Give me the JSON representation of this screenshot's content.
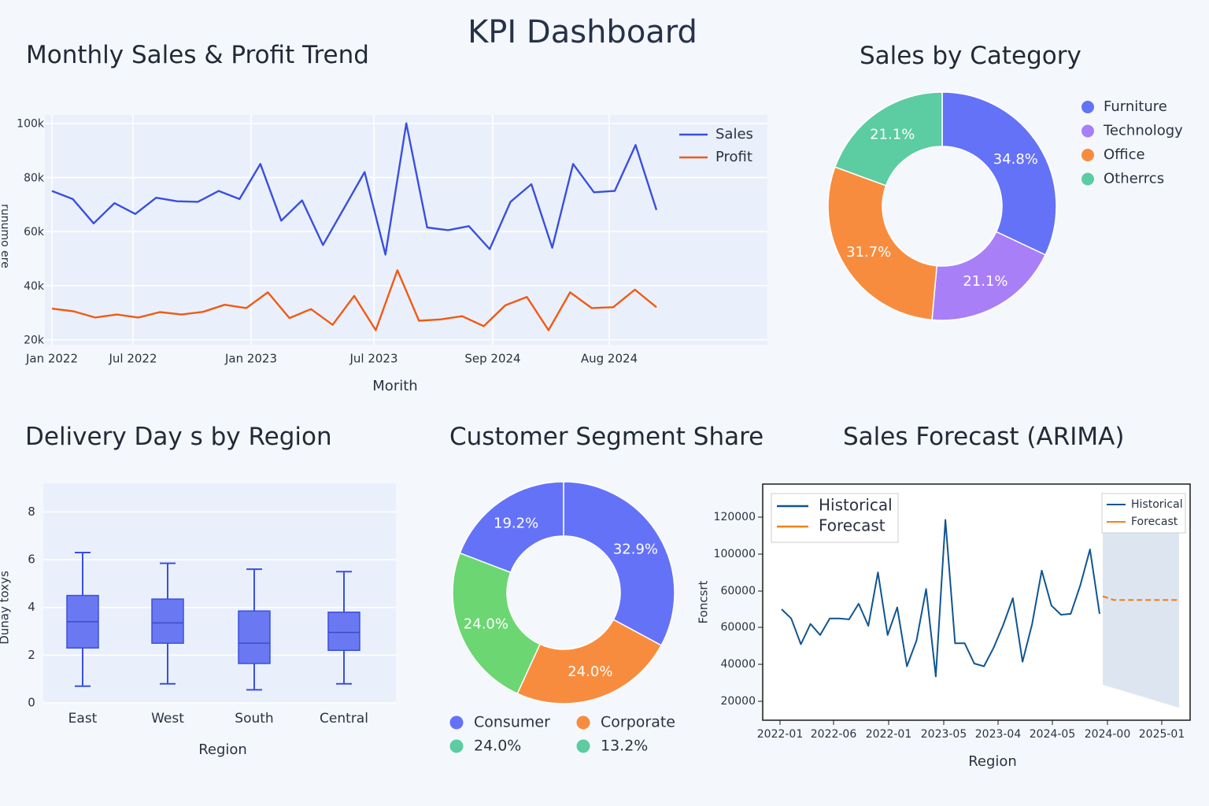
{
  "dashboard": {
    "title": "KPI Dashboard"
  },
  "colors": {
    "plot_bg": "#eaf0fb",
    "sales": "#3a4fe0",
    "profit": "#f05a14",
    "indigo": "#6472f8",
    "purple": "#a97ff8",
    "orange": "#f88c3e",
    "teal": "#5ccca2",
    "green": "#6cd672",
    "navy": "#0f5592",
    "fc_orange": "#f47f1a"
  },
  "panels": {
    "trend": {
      "title": "Monthly Sales & Profit Trend",
      "xlabel": "Morith",
      "ylabel": "runumo ere",
      "legend": [
        "Sales",
        "Profit"
      ]
    },
    "category": {
      "title": "Sales by Category",
      "legend": [
        "Furniture",
        "Technology",
        "Office",
        "Otherrcs"
      ]
    },
    "delivery": {
      "title": "Delivery Day s by Region",
      "xlabel": "Region",
      "ylabel": "Dunay toxys"
    },
    "segment": {
      "title": "Customer Segment Share",
      "legend": [
        "Consumer",
        "Corporate",
        "24.0%",
        "13.2%"
      ]
    },
    "forecast": {
      "title": "Sales Forecast (ARIMA)",
      "xlabel": "Region",
      "ylabel": "Foncsrt",
      "legend_main": [
        "Historical",
        "Forecast"
      ],
      "legend_small": [
        "Historical",
        "Forecast"
      ]
    }
  },
  "chart_data": [
    {
      "type": "line",
      "title": "Monthly Sales & Profit Trend",
      "xlabel": "Morith",
      "ylabel": "runumo ere",
      "xtick_labels": [
        "Jan 2022",
        "Jul 2022",
        "Jan 2023",
        "Jul 2023",
        "Sep 2024",
        "Aug 2024"
      ],
      "yticks": [
        20000,
        40000,
        60000,
        80000,
        100000
      ],
      "ytick_labels": [
        "20k",
        "40k",
        "60k",
        "80k",
        "100k"
      ],
      "ylim": [
        19000,
        104000
      ],
      "legend_position": "top-right",
      "grid": true,
      "series": [
        {
          "name": "Sales",
          "values": [
            75000,
            72000,
            63000,
            70500,
            66500,
            72500,
            71200,
            71000,
            75000,
            72000,
            85000,
            64000,
            71500,
            55000,
            68500,
            82000,
            51500,
            100000,
            61500,
            60500,
            62000,
            53500,
            71000,
            77500,
            54000,
            85000,
            74500,
            75000,
            92000,
            68000
          ]
        },
        {
          "name": "Profit",
          "values": [
            31500,
            30500,
            28200,
            29300,
            28200,
            30200,
            29300,
            30300,
            32900,
            31700,
            37500,
            28000,
            31300,
            25500,
            36200,
            23500,
            45700,
            27000,
            27500,
            28700,
            25000,
            32700,
            35800,
            23500,
            37500,
            31700,
            32000,
            38500,
            32000
          ]
        }
      ]
    },
    {
      "type": "pie",
      "title": "Sales by Category",
      "donut": true,
      "categories": [
        "Furniture",
        "Technology",
        "Office",
        "Otherrcs"
      ],
      "values": [
        34.8,
        21.1,
        31.7,
        21.1
      ],
      "labels": [
        "34.8%",
        "21.1%",
        "31.7%",
        "21.1%"
      ],
      "legend_position": "right"
    },
    {
      "type": "box",
      "title": "Delivery Day s by Region",
      "xlabel": "Region",
      "ylabel": "Dunay toxys",
      "categories": [
        "East",
        "West",
        "South",
        "Central"
      ],
      "boxes": [
        {
          "min": 0.7,
          "q1": 2.3,
          "median": 3.4,
          "q3": 4.5,
          "max": 6.3
        },
        {
          "min": 0.8,
          "q1": 2.5,
          "median": 3.35,
          "q3": 4.35,
          "max": 5.85
        },
        {
          "min": 0.55,
          "q1": 1.65,
          "median": 2.5,
          "q3": 3.85,
          "max": 5.6
        },
        {
          "min": 0.8,
          "q1": 2.2,
          "median": 2.95,
          "q3": 3.8,
          "max": 5.5
        }
      ],
      "yticks": [
        0,
        2,
        4,
        6,
        8
      ],
      "ylim": [
        0,
        9.2
      ],
      "grid": true
    },
    {
      "type": "pie",
      "title": "Customer Segment Share",
      "donut": true,
      "values": [
        32.9,
        24.0,
        24.0,
        19.2
      ],
      "labels": [
        "32.9%",
        "24.0%",
        "24.0%",
        "19.2%"
      ],
      "legend_entries": [
        "Consumer",
        "Corporate",
        "24.0%",
        "13.2%"
      ],
      "legend_position": "bottom"
    },
    {
      "type": "line",
      "title": "Sales Forecast (ARIMA)",
      "xlabel": "Region",
      "ylabel": "Foncsrt",
      "xtick_labels": [
        "2022-01",
        "2022-06",
        "2022-01",
        "2023-05",
        "2023-04",
        "2024-05",
        "2024-00",
        "2025-01"
      ],
      "ytick_labels": [
        "20000",
        "40000",
        "60000",
        "60000",
        "100000",
        "120000"
      ],
      "legend_position": "top-left",
      "grid": false,
      "series": [
        {
          "name": "Historical",
          "values": [
            70000,
            65000,
            51000,
            62000,
            56000,
            65000,
            65000,
            64500,
            73000,
            61000,
            90000,
            56000,
            71000,
            39000,
            53000,
            81000,
            33500,
            118500,
            51500,
            51500,
            40500,
            39000,
            49000,
            61500,
            76000,
            41500,
            62000,
            91000,
            72000,
            67000,
            67500,
            83000,
            102500,
            67500
          ]
        },
        {
          "name": "Forecast",
          "values": [
            77000,
            75000,
            75000,
            75000,
            75000,
            75000,
            75000,
            75000
          ]
        }
      ],
      "confidence_band": {
        "upper": [
          113000,
          113000
        ],
        "lower": [
          29000,
          16500
        ]
      }
    }
  ]
}
